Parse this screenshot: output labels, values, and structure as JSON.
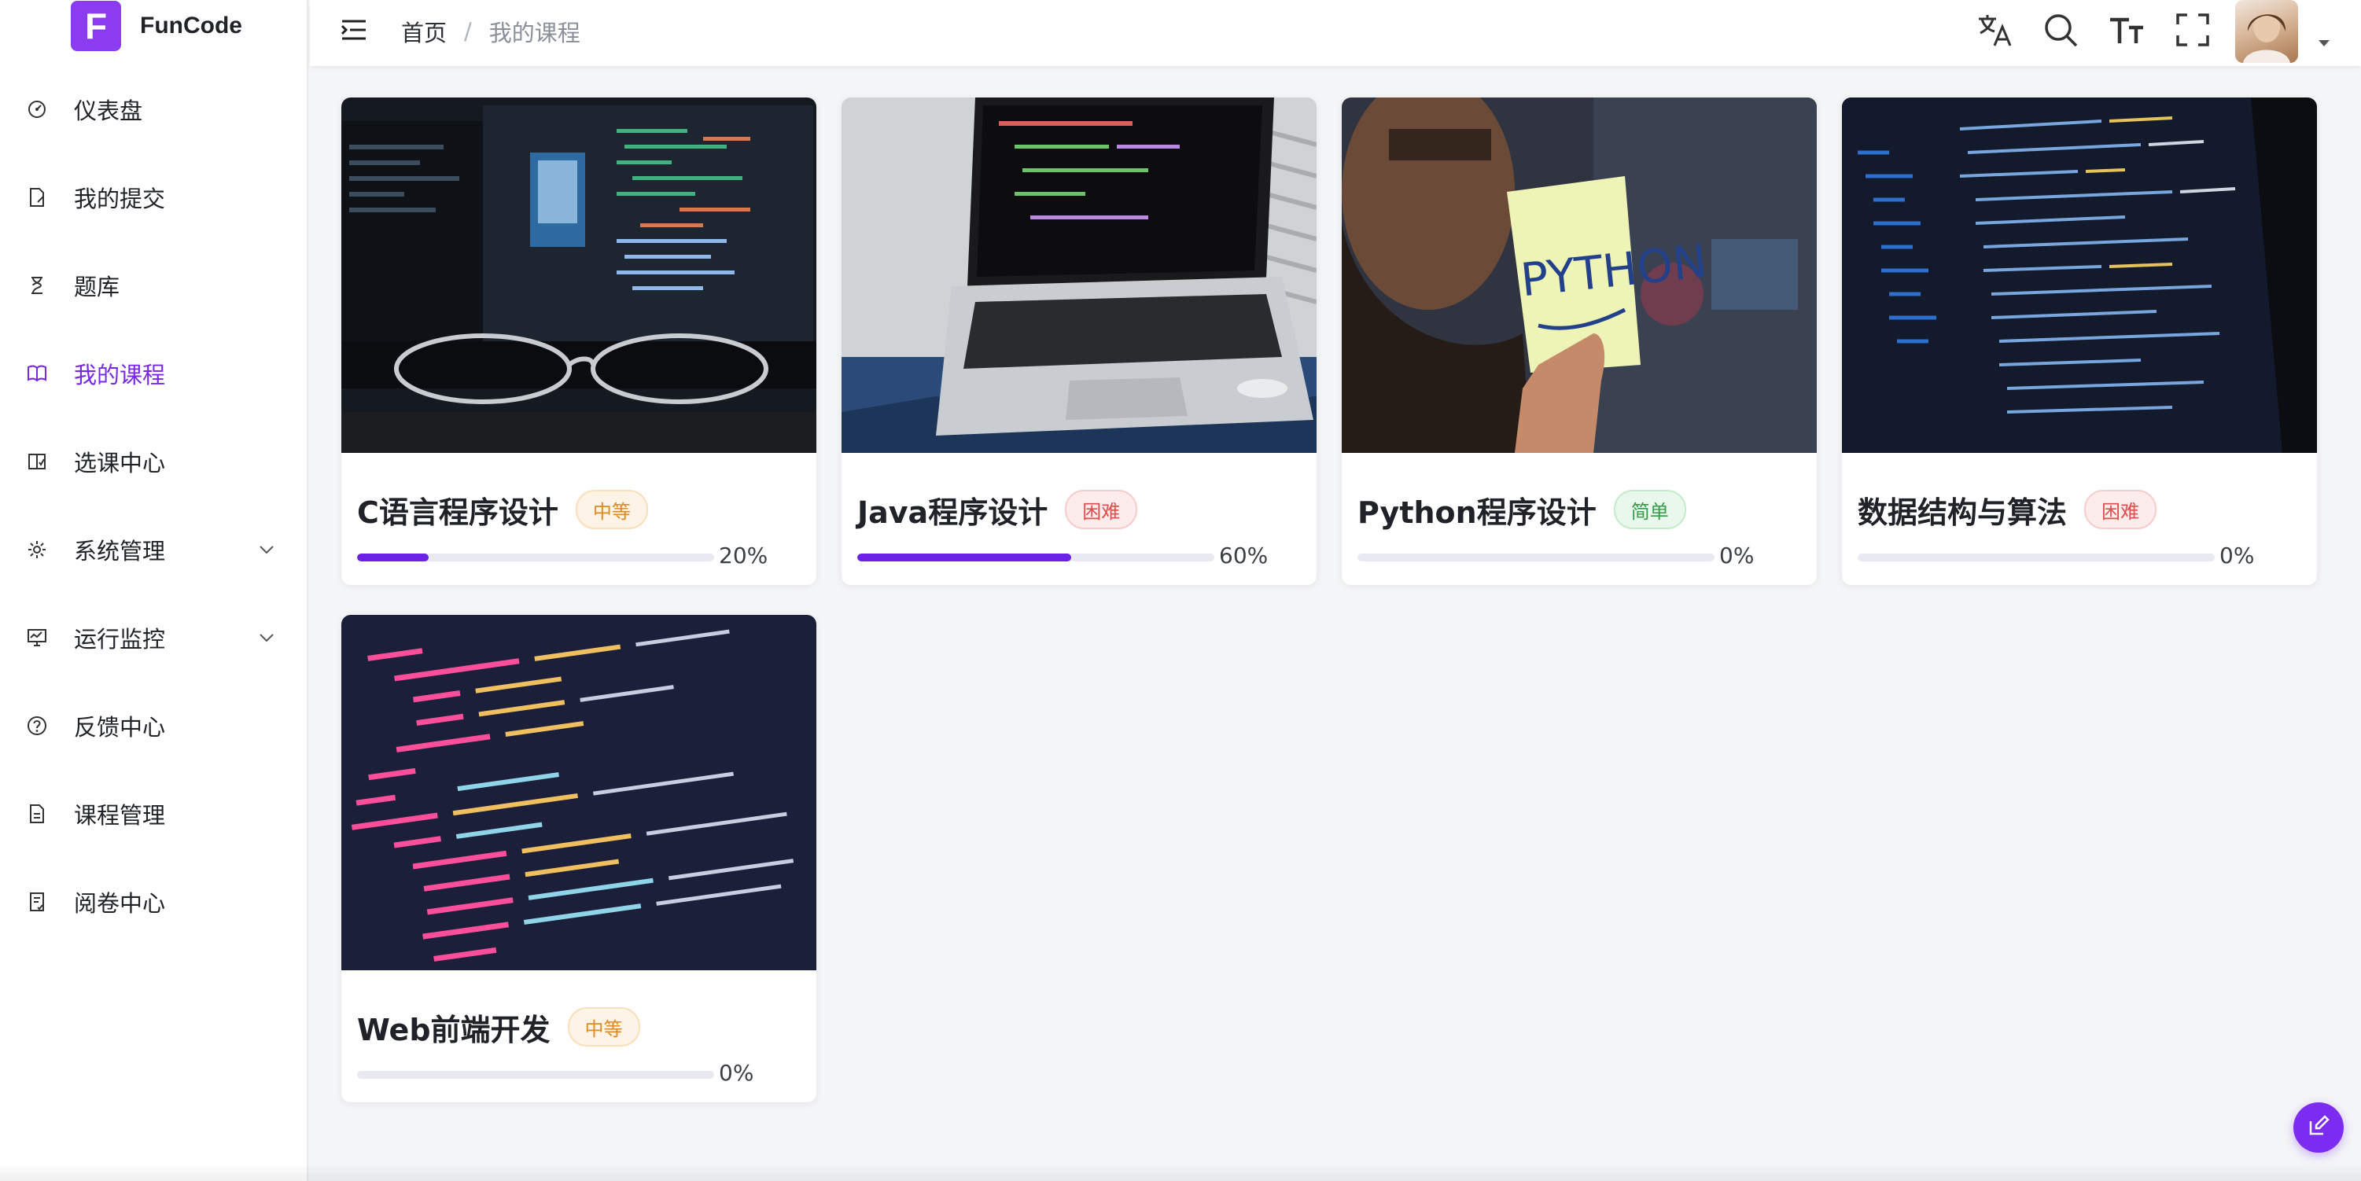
{
  "app": {
    "logo_letter": "F",
    "name": "FunCode",
    "accent": "#7a28e8"
  },
  "sidebar": {
    "items": [
      {
        "label": "仪表盘",
        "icon": "dashboard-icon"
      },
      {
        "label": "我的提交",
        "icon": "submission-icon"
      },
      {
        "label": "题库",
        "icon": "question-bank-icon"
      },
      {
        "label": "我的课程",
        "icon": "book-icon",
        "active": true
      },
      {
        "label": "选课中心",
        "icon": "course-select-icon"
      },
      {
        "label": "系统管理",
        "icon": "gear-icon",
        "expandable": true
      },
      {
        "label": "运行监控",
        "icon": "monitor-icon",
        "expandable": true
      },
      {
        "label": "反馈中心",
        "icon": "question-circle-icon"
      },
      {
        "label": "课程管理",
        "icon": "document-icon"
      },
      {
        "label": "阅卷中心",
        "icon": "grading-icon"
      }
    ]
  },
  "header": {
    "breadcrumb": {
      "home": "首页",
      "separator": "/",
      "current": "我的课程"
    },
    "icons": [
      "translate-icon",
      "search-icon",
      "font-size-icon",
      "fullscreen-icon"
    ]
  },
  "courses": [
    {
      "title": "C语言程序设计",
      "difficulty": "中等",
      "level": "mid",
      "progress": 20,
      "progress_text": "20%"
    },
    {
      "title": "Java程序设计",
      "difficulty": "困难",
      "level": "hard",
      "progress": 60,
      "progress_text": "60%"
    },
    {
      "title": "Python程序设计",
      "difficulty": "简单",
      "level": "easy",
      "progress": 0,
      "progress_text": "0%",
      "cover_note": "PYTHON"
    },
    {
      "title": "数据结构与算法",
      "difficulty": "困难",
      "level": "hard",
      "progress": 0,
      "progress_text": "0%"
    },
    {
      "title": "Web前端开发",
      "difficulty": "中等",
      "level": "mid",
      "progress": 0,
      "progress_text": "0%"
    }
  ]
}
